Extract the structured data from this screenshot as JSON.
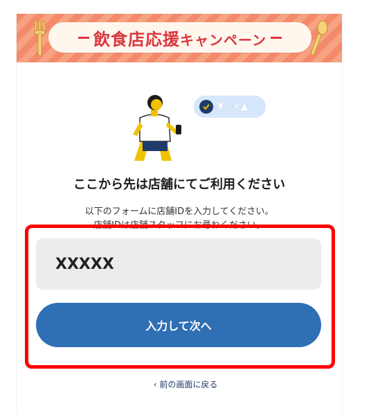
{
  "banner": {
    "title_part1": "飲食店応援",
    "title_part2": "キャンペーン"
  },
  "illustration": {
    "bubble_text": "¥○×▲"
  },
  "main": {
    "heading": "ここから先は店舗にてご利用ください",
    "instruction_line1": "以下のフォームに店舗IDを入力してください。",
    "instruction_line2": "店舗IDは店舗スタッフにお尋ねください。"
  },
  "form": {
    "store_id_value": "XXXXX",
    "submit_label": "入力して次へ"
  },
  "footer": {
    "back_label": "前の画面に戻る",
    "back_icon": "chevron-left-icon"
  },
  "colors": {
    "banner_red": "#d9363e",
    "button_blue": "#2f6fb3",
    "highlight_red": "#ff0000"
  }
}
